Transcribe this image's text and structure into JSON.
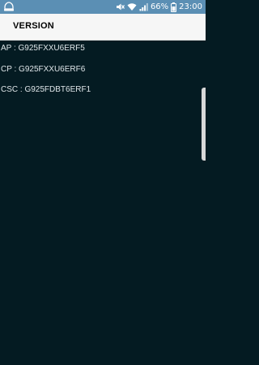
{
  "status_bar": {
    "battery_percent": "66%",
    "time": "23:00",
    "icons": [
      "notification-icon",
      "mute-icon",
      "wifi-icon",
      "signal-icon",
      "battery-icon"
    ]
  },
  "header": {
    "title": "VERSION"
  },
  "versions": {
    "ap": "AP : G925FXXU6ERF5",
    "cp": "CP : G925FXXU6ERF6",
    "csc": "CSC : G925FDBT6ERF1"
  },
  "colors": {
    "status_bar": "#5b8fb4",
    "app_bar": "#f6f6f6",
    "background": "#041b22",
    "text": "#dfe6e9"
  }
}
